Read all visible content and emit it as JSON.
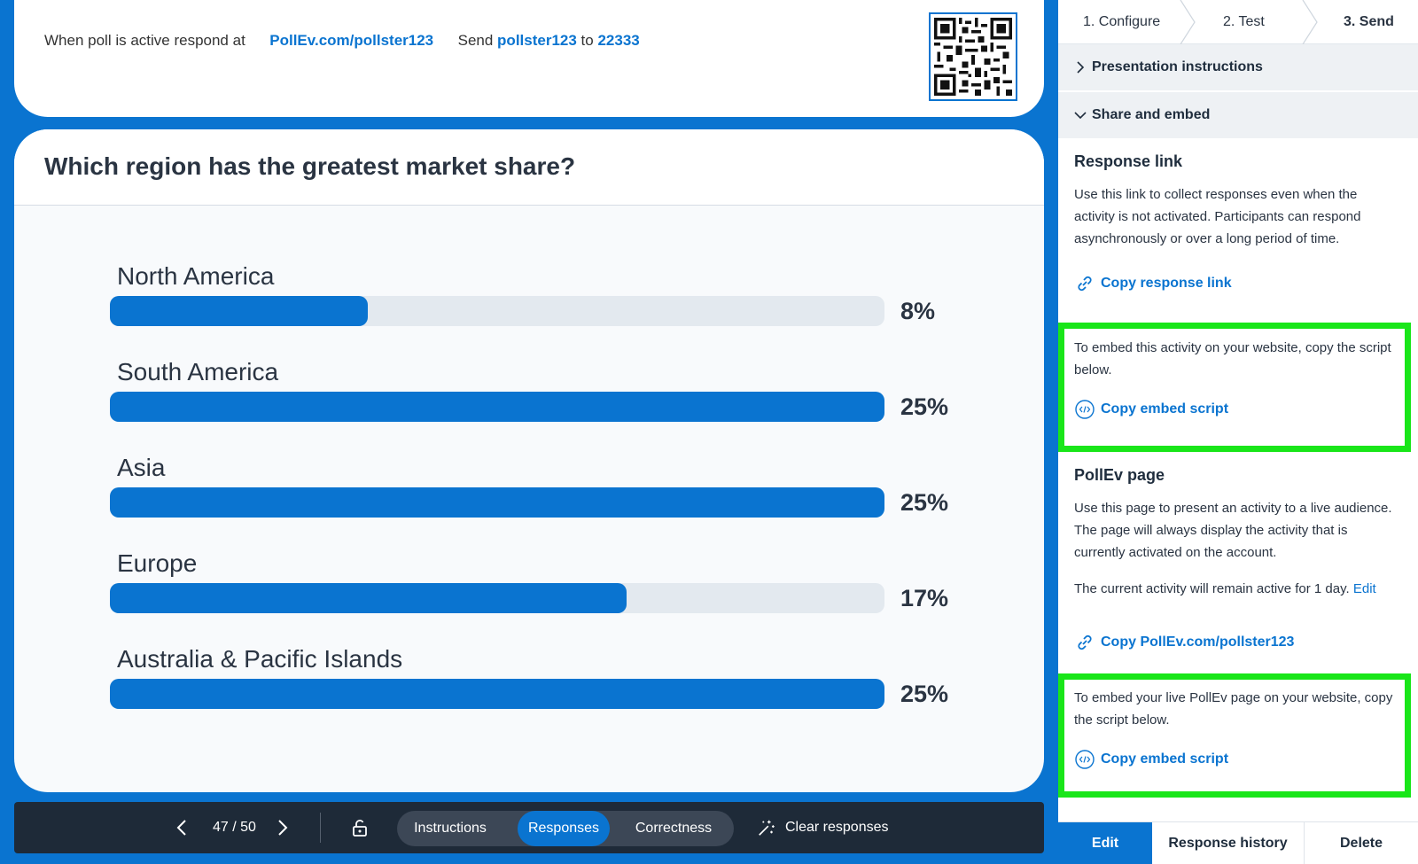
{
  "header": {
    "respond_prefix": "When poll is active respond at",
    "respond_url": "PollEv.com/pollster123",
    "send_word": "Send",
    "keyword": "pollster123",
    "to_word": "to",
    "number": "22333"
  },
  "question": {
    "title": "Which region has the greatest market share?",
    "options": [
      {
        "label": "North America",
        "percent_text": "8%",
        "fill_fraction": 0.333
      },
      {
        "label": "South America",
        "percent_text": "25%",
        "fill_fraction": 1.0
      },
      {
        "label": "Asia",
        "percent_text": "25%",
        "fill_fraction": 1.0
      },
      {
        "label": "Europe",
        "percent_text": "17%",
        "fill_fraction": 0.667
      },
      {
        "label": "Australia & Pacific Islands",
        "percent_text": "25%",
        "fill_fraction": 1.0
      }
    ]
  },
  "toolbar": {
    "page_indicator": "47 / 50",
    "tabs": [
      "Instructions",
      "Responses",
      "Correctness"
    ],
    "active_tab": "Responses",
    "clear_label": "Clear responses"
  },
  "panel": {
    "steps": [
      "1. Configure",
      "2. Test",
      "3. Send"
    ],
    "current_step": "3. Send",
    "presentation_instructions": "Presentation instructions",
    "share_and_embed": "Share and embed",
    "response_link": {
      "title": "Response link",
      "text": "Use this link to collect responses even when the activity is not activated. Participants can respond asynchronously or over a long period of time.",
      "copy_label": "Copy response link"
    },
    "embed_activity": {
      "text": "To embed this activity on your website, copy the script below.",
      "copy_label": "Copy embed script"
    },
    "pollev_page": {
      "title": "PollEv page",
      "text": "Use this page to present an activity to a live audience. The page will always display the activity that is currently activated on the account.",
      "active_text": "The current activity will remain active for 1 day.",
      "edit_label": "Edit",
      "copy_label": "Copy PollEv.com/pollster123"
    },
    "embed_page": {
      "text": "To embed your live PollEv page on your website, copy the script below.",
      "copy_label": "Copy embed script"
    },
    "footer": {
      "edit": "Edit",
      "history": "Response history",
      "delete": "Delete"
    }
  },
  "colors": {
    "brand_blue": "#0a74d0",
    "highlight_green": "#19e619",
    "toolbar_dark": "#1e2a38"
  },
  "icons": [
    "qr-code-icon",
    "chevron-left-icon",
    "chevron-right-icon",
    "unlock-icon",
    "clear-sparkle-icon",
    "link-icon",
    "code-icon",
    "chevron-down-icon"
  ]
}
